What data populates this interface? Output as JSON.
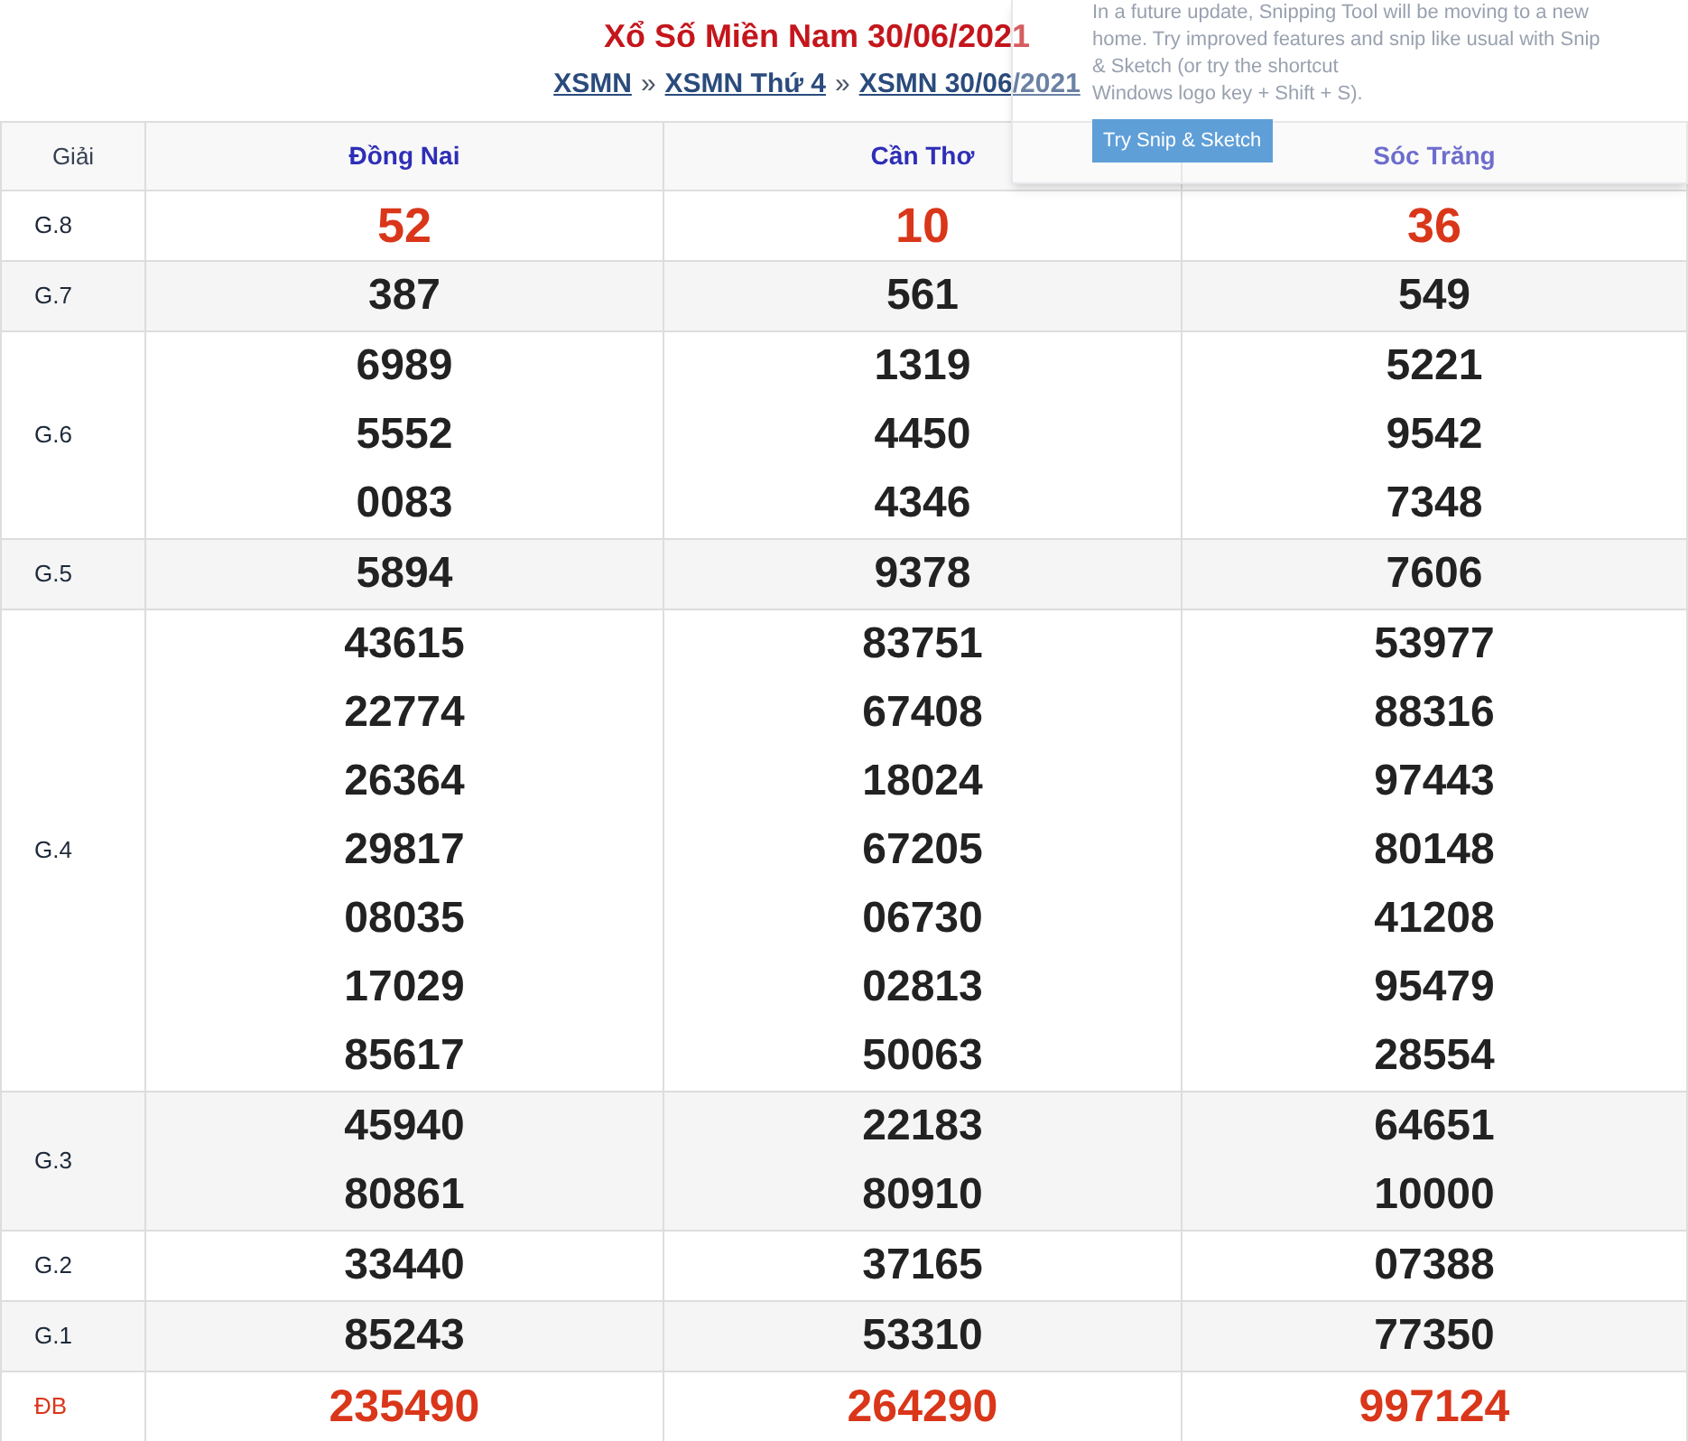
{
  "title": "Xổ Số Miền Nam 30/06/2021",
  "breadcrumb": [
    {
      "label": "XSMN",
      "separator": "»"
    },
    {
      "label": "XSMN Thứ 4",
      "separator": "»"
    },
    {
      "label": "XSMN 30/06/2021"
    }
  ],
  "table": {
    "prize_header": "Giải",
    "provinces": [
      "Đồng Nai",
      "Cần Thơ",
      "Sóc Trăng"
    ],
    "rows": [
      {
        "prize": "G.8",
        "kind": "eighth",
        "results": [
          [
            "52"
          ],
          [
            "10"
          ],
          [
            "36"
          ]
        ]
      },
      {
        "prize": "G.7",
        "kind": "regular",
        "results": [
          [
            "387"
          ],
          [
            "561"
          ],
          [
            "549"
          ]
        ]
      },
      {
        "prize": "G.6",
        "kind": "regular",
        "results": [
          [
            "6989",
            "5552",
            "0083"
          ],
          [
            "1319",
            "4450",
            "4346"
          ],
          [
            "5221",
            "9542",
            "7348"
          ]
        ]
      },
      {
        "prize": "G.5",
        "kind": "regular",
        "results": [
          [
            "5894"
          ],
          [
            "9378"
          ],
          [
            "7606"
          ]
        ]
      },
      {
        "prize": "G.4",
        "kind": "regular",
        "results": [
          [
            "43615",
            "22774",
            "26364",
            "29817",
            "08035",
            "17029",
            "85617"
          ],
          [
            "83751",
            "67408",
            "18024",
            "67205",
            "06730",
            "02813",
            "50063"
          ],
          [
            "53977",
            "88316",
            "97443",
            "80148",
            "41208",
            "95479",
            "28554"
          ]
        ]
      },
      {
        "prize": "G.3",
        "kind": "regular",
        "results": [
          [
            "45940",
            "80861"
          ],
          [
            "22183",
            "80910"
          ],
          [
            "64651",
            "10000"
          ]
        ]
      },
      {
        "prize": "G.2",
        "kind": "regular",
        "results": [
          [
            "33440"
          ],
          [
            "37165"
          ],
          [
            "07388"
          ]
        ]
      },
      {
        "prize": "G.1",
        "kind": "regular",
        "results": [
          [
            "85243"
          ],
          [
            "53310"
          ],
          [
            "77350"
          ]
        ]
      },
      {
        "prize": "ĐB",
        "kind": "special",
        "results": [
          [
            "235490"
          ],
          [
            "264290"
          ],
          [
            "997124"
          ]
        ]
      }
    ]
  },
  "notification": {
    "lines": [
      "In a future update, Snipping Tool will be moving to a new",
      "home. Try improved features and snip like usual with Snip",
      "& Sketch (or try the shortcut",
      "Windows logo key + Shift + S)."
    ],
    "button": "Try Snip & Sketch"
  }
}
